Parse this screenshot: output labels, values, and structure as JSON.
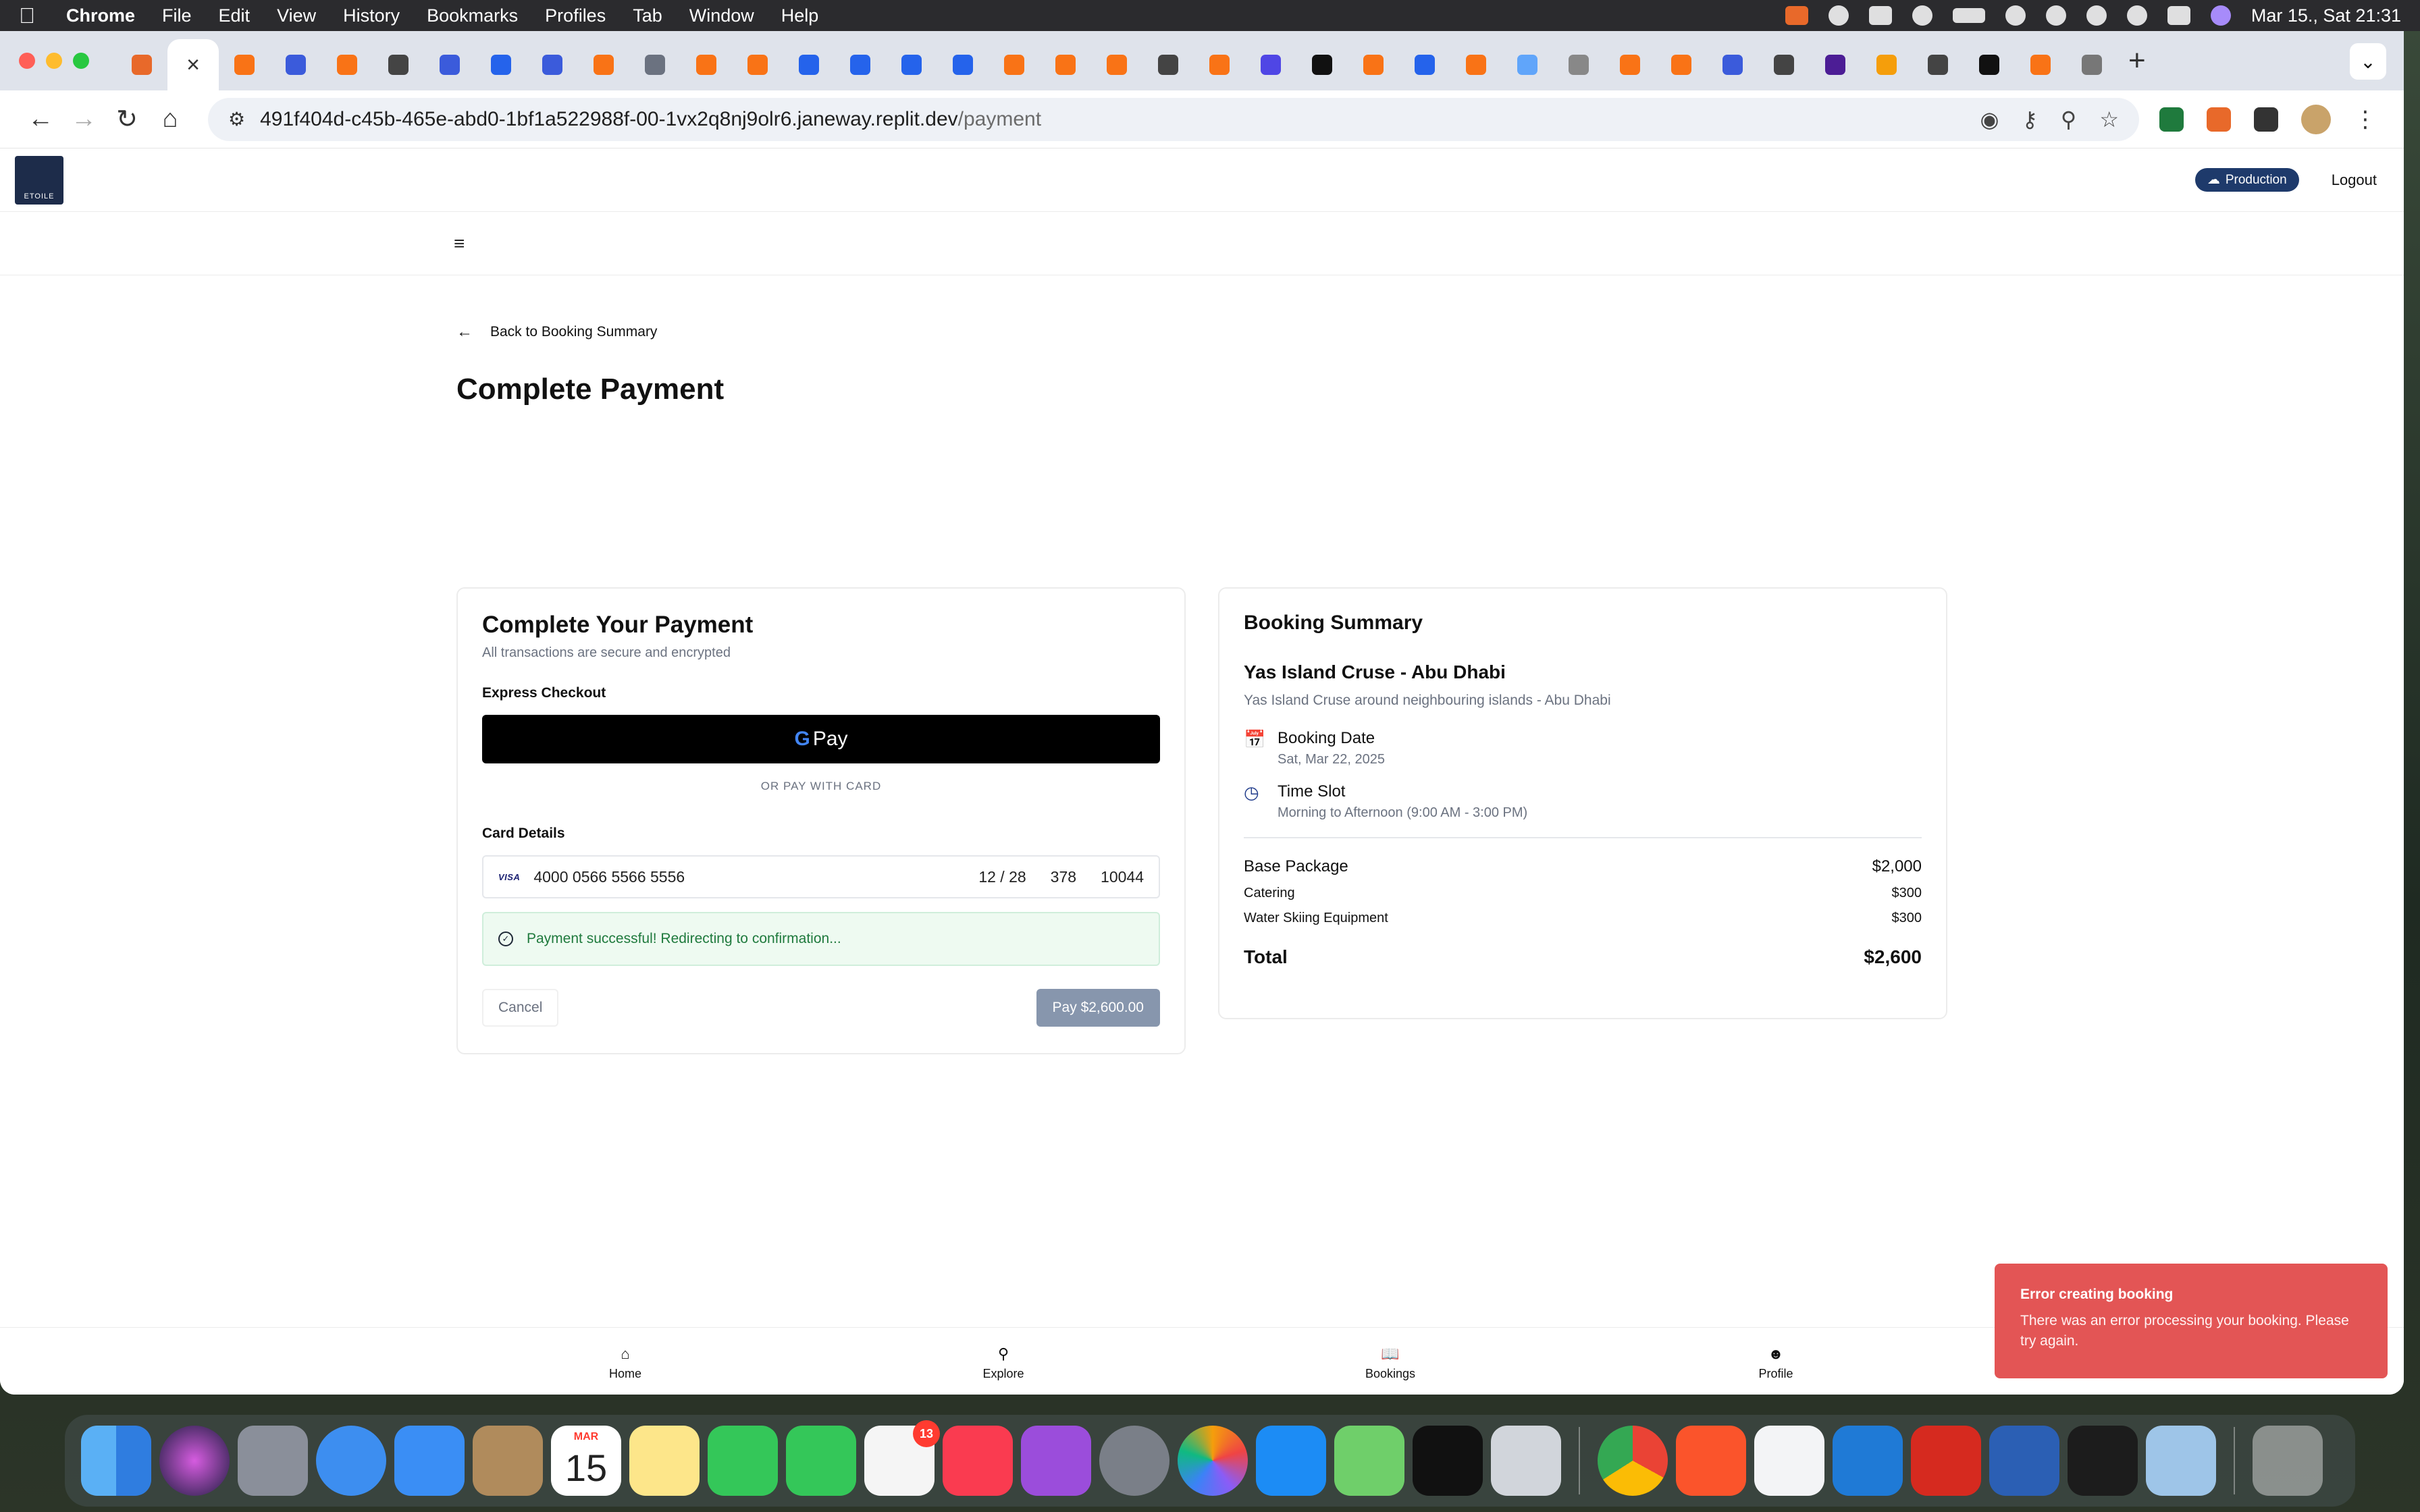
{
  "menubar": {
    "app_name": "Chrome",
    "items": [
      "File",
      "Edit",
      "View",
      "History",
      "Bookmarks",
      "Profiles",
      "Tab",
      "Window",
      "Help"
    ],
    "datetime": "Mar 15., Sat  21:31"
  },
  "browser": {
    "url_host": "491f404d-c45b-465e-abd0-1bf1a522988f-00-1vx2q8nj9olr6.janeway.replit.dev",
    "url_path": "/payment",
    "tab_favicons": [
      "#e8692a",
      "#2563eb",
      "#f97316",
      "#3b5bdb",
      "#f97316",
      "#444444",
      "#3b5bdb",
      "#2563eb",
      "#3b5bdb",
      "#f97316",
      "#6b7280",
      "#f97316",
      "#f97316",
      "#2563eb",
      "#2563eb",
      "#2563eb",
      "#2563eb",
      "#f97316",
      "#f97316",
      "#f97316",
      "#444444",
      "#f97316",
      "#4f46e5",
      "#111111",
      "#f97316",
      "#2563eb",
      "#f97316",
      "#60a5fa",
      "#888888",
      "#f97316",
      "#f97316",
      "#3b5bdb",
      "#444444",
      "#4c1d95",
      "#f59e0b",
      "#444444",
      "#111111",
      "#f97316",
      "#777777"
    ]
  },
  "app": {
    "logo_text": "ETOILE",
    "environment": "Production",
    "logout_label": "Logout"
  },
  "page": {
    "back_label": "Back to Booking Summary",
    "title": "Complete Payment"
  },
  "payment": {
    "title": "Complete Your Payment",
    "subtitle": "All transactions are secure and encrypted",
    "express_label": "Express Checkout",
    "gpay_label": "Pay",
    "divider_label": "OR PAY WITH CARD",
    "card_details_label": "Card Details",
    "card_brand": "VISA",
    "card_number": "4000 0566 5566 5556",
    "expiry": "12 / 28",
    "cvc": "378",
    "zip": "10044",
    "success_message": "Payment successful! Redirecting to confirmation...",
    "cancel_label": "Cancel",
    "pay_label": "Pay $2,600.00"
  },
  "summary": {
    "title": "Booking Summary",
    "name": "Yas Island Cruse - Abu Dhabi",
    "description": "Yas Island Cruse around neighbouring islands - Abu Dhabi",
    "date_label": "Booking Date",
    "date_value": "Sat, Mar 22, 2025",
    "slot_label": "Time Slot",
    "slot_value": "Morning to Afternoon (9:00 AM - 3:00 PM)",
    "base_label": "Base Package",
    "base_value": "$2,000",
    "addons": [
      {
        "label": "Catering",
        "value": "$300"
      },
      {
        "label": "Water Skiing Equipment",
        "value": "$300"
      }
    ],
    "total_label": "Total",
    "total_value": "$2,600"
  },
  "bottom_nav": [
    {
      "label": "Home",
      "icon": "home-icon"
    },
    {
      "label": "Explore",
      "icon": "search-icon"
    },
    {
      "label": "Bookings",
      "icon": "book-icon"
    },
    {
      "label": "Profile",
      "icon": "user-icon"
    }
  ],
  "toast": {
    "title": "Error creating booking",
    "body": "There was an error processing your booking. Please try again."
  },
  "dock": {
    "calendar_month": "MAR",
    "calendar_day": "15",
    "reminders_badge": "13"
  },
  "colors": {
    "accent": "#1e3a6b",
    "pay_button": "#8796ad",
    "success_text": "#1f7a3d",
    "toast_bg": "#e35555"
  }
}
